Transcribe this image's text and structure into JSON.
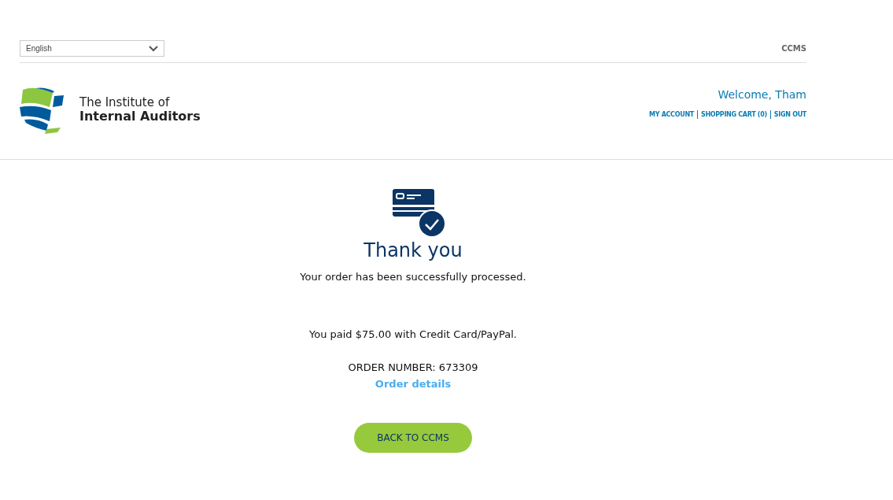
{
  "language_select": {
    "value": "English"
  },
  "top_link": "CCMS",
  "logo": {
    "line_1": "The Institute of",
    "line_2": "Internal Auditors"
  },
  "welcome": "Welcome, Tham",
  "account_links": [
    "MY ACCOUNT",
    "SHOPPING CART (0)",
    "SIGN OUT"
  ],
  "confirmation": {
    "title": "Thank you",
    "message": "Your order has been successfully processed.",
    "payment": "You paid $75.00 with Credit Card/PayPal.",
    "order_number": "ORDER NUMBER: 673309",
    "details_link": "Order details",
    "button": "BACK TO CCMS"
  }
}
